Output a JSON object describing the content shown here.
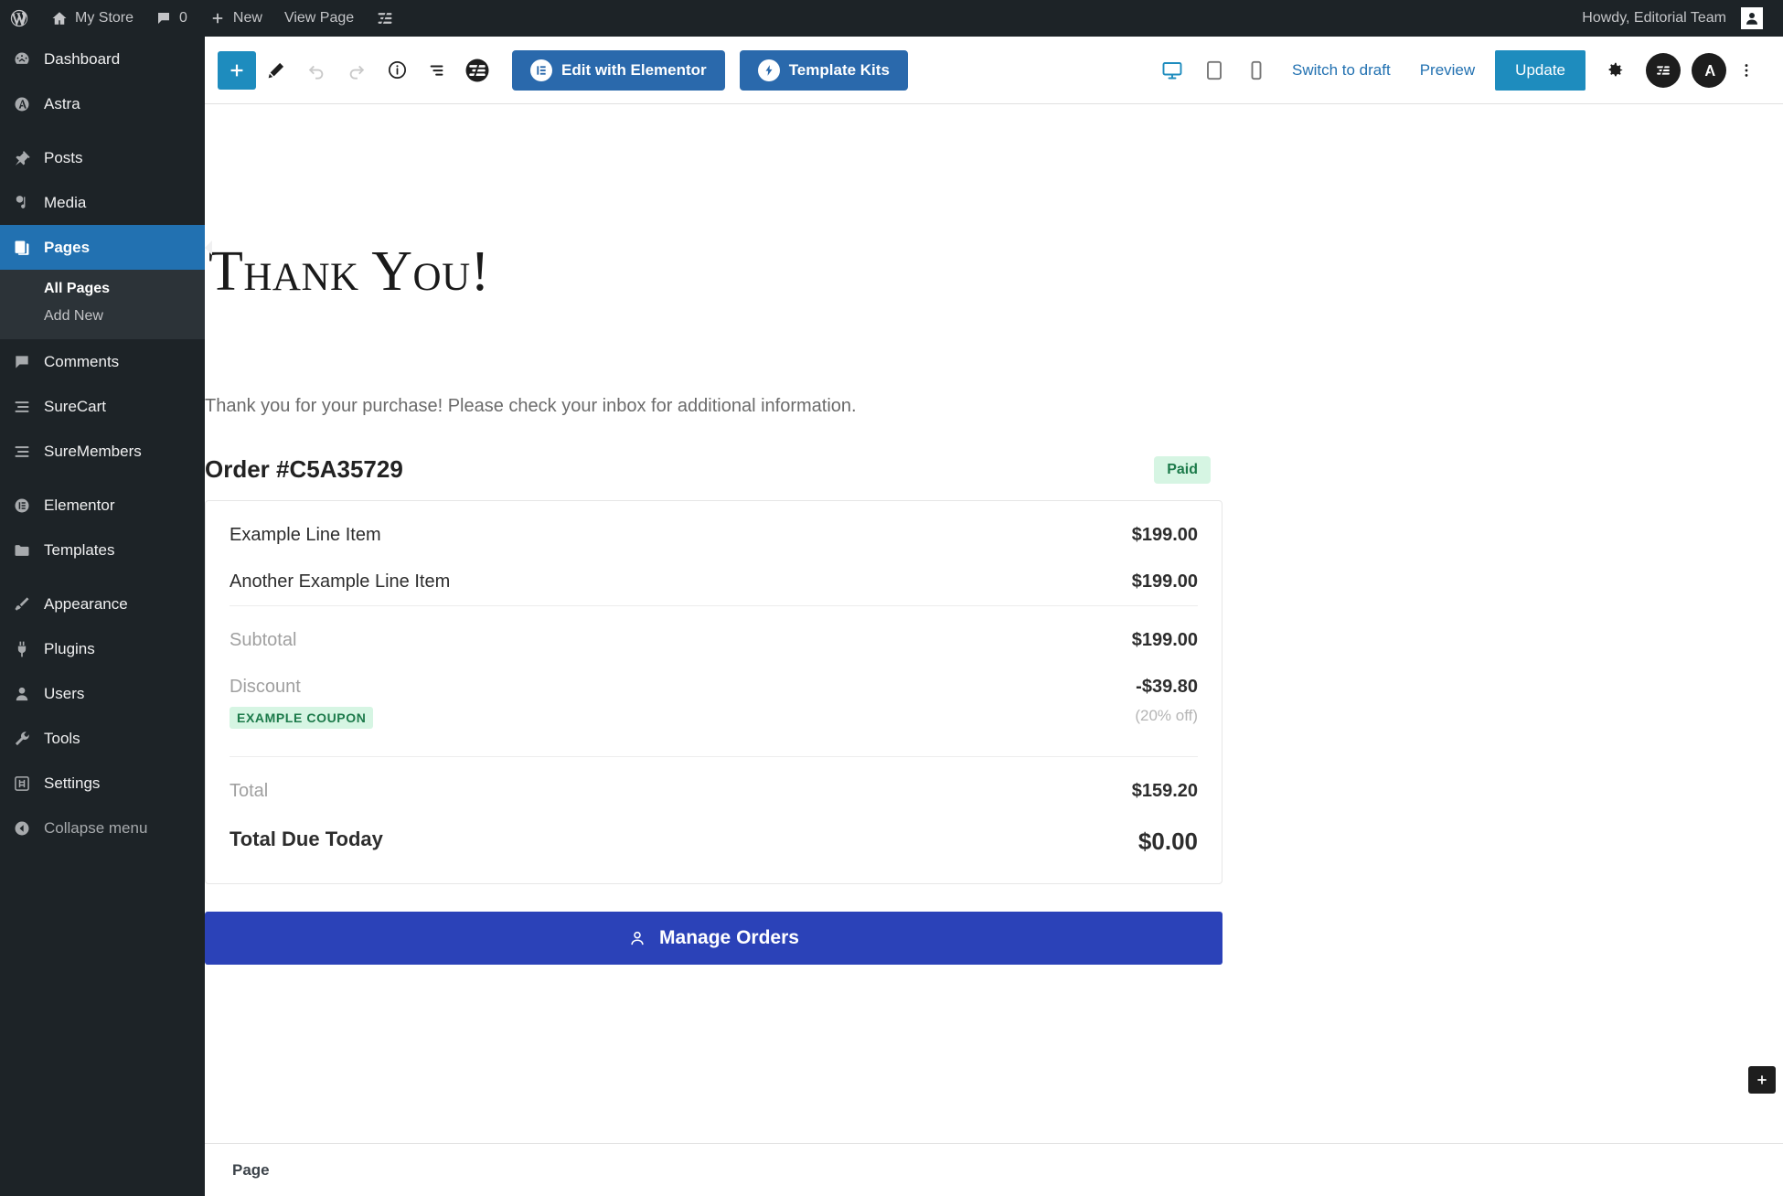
{
  "adminbar": {
    "logo_icon": "wordpress-icon",
    "site_icon": "home-icon",
    "site_name": "My Store",
    "comments_icon": "comment-bubble-icon",
    "comments_count": "0",
    "new_icon": "plus-icon",
    "new_label": "New",
    "view_page_label": "View Page",
    "surecart_icon": "surecart-icon",
    "howdy": "Howdy, Editorial Team",
    "avatar_icon": "user-avatar-icon"
  },
  "sidebar": {
    "items": [
      {
        "label": "Dashboard",
        "icon": "dashboard-icon",
        "active": false
      },
      {
        "label": "Astra",
        "icon": "astra-icon",
        "active": false
      },
      {
        "label": "Posts",
        "icon": "pin-icon",
        "active": false
      },
      {
        "label": "Media",
        "icon": "media-icon",
        "active": false
      },
      {
        "label": "Pages",
        "icon": "pages-icon",
        "active": true
      },
      {
        "label": "Comments",
        "icon": "comment-bubble-icon",
        "active": false
      },
      {
        "label": "SureCart",
        "icon": "surecart-icon",
        "active": false
      },
      {
        "label": "SureMembers",
        "icon": "suremembers-icon",
        "active": false
      },
      {
        "label": "Elementor",
        "icon": "elementor-icon",
        "active": false
      },
      {
        "label": "Templates",
        "icon": "folder-icon",
        "active": false
      },
      {
        "label": "Appearance",
        "icon": "paintbrush-icon",
        "active": false
      },
      {
        "label": "Plugins",
        "icon": "plug-icon",
        "active": false
      },
      {
        "label": "Users",
        "icon": "user-icon",
        "active": false
      },
      {
        "label": "Tools",
        "icon": "wrench-icon",
        "active": false
      },
      {
        "label": "Settings",
        "icon": "settings-sliders-icon",
        "active": false
      },
      {
        "label": "Collapse menu",
        "icon": "collapse-arrow-icon",
        "active": false
      }
    ],
    "submenu": [
      {
        "label": "All Pages",
        "current": true
      },
      {
        "label": "Add New",
        "current": false
      }
    ]
  },
  "toolbar": {
    "add_block_icon": "plus-icon",
    "edit_tool_icon": "pencil-icon",
    "undo_icon": "undo-arrow-icon",
    "redo_icon": "redo-arrow-icon",
    "details_icon": "info-circle-icon",
    "list_view_icon": "list-view-icon",
    "surecart_icon": "surecart-icon",
    "elementor_button": "Edit with Elementor",
    "elementor_badge_icon": "elementor-icon",
    "template_kits_button": "Template Kits",
    "template_kits_badge_icon": "envato-bolt-icon",
    "device_desktop_icon": "desktop-icon",
    "device_tablet_icon": "tablet-icon",
    "device_mobile_icon": "mobile-icon",
    "switch_to_draft": "Switch to draft",
    "preview": "Preview",
    "update": "Update",
    "settings_icon": "gear-icon",
    "surecart_round_icon": "surecart-icon",
    "astra_round_icon": "astra-icon",
    "more_options_icon": "kebab-menu-icon"
  },
  "canvas": {
    "heading": "Thank You!",
    "paragraph": "Thank you for your purchase! Please check your inbox for additional information.",
    "order": {
      "title": "Order #C5A35729",
      "status_badge": "Paid",
      "line_items": [
        {
          "label": "Example Line Item",
          "amount": "$199.00"
        },
        {
          "label": "Another Example Line Item",
          "amount": "$199.00"
        }
      ],
      "subtotal_label": "Subtotal",
      "subtotal_value": "$199.00",
      "discount_label": "Discount",
      "discount_value": "-$39.80",
      "coupon_chip": "EXAMPLE COUPON",
      "coupon_note": "(20% off)",
      "total_label": "Total",
      "total_value": "$159.20",
      "total_due_label": "Total Due Today",
      "total_due_value": "$0.00"
    },
    "manage_orders_button": "Manage Orders",
    "manage_orders_icon": "user-icon",
    "float_add_icon": "plus-icon"
  },
  "footer": {
    "breadcrumb": "Page"
  },
  "colors": {
    "admin_dark": "#1d2327",
    "admin_accent": "#2271b1",
    "wp_blue": "#1e8cbe",
    "elementor_blue": "#2a69ac",
    "manage_orders_blue": "#2b42b8",
    "paid_badge_bg": "#d6f5e3",
    "paid_badge_text": "#1c7a4a"
  }
}
